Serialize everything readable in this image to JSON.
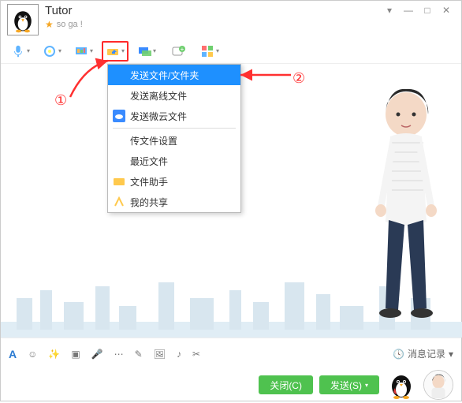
{
  "header": {
    "contact_name": "Tutor",
    "status_text": "so ga !"
  },
  "win_controls": {
    "options": "▾",
    "min": "—",
    "max": "□",
    "close": "✕"
  },
  "toolbar": {
    "voice_icon": "voice",
    "video_icon": "video",
    "screen_icon": "screen",
    "file_icon": "file",
    "remote_icon": "remote",
    "add_icon": "add",
    "app_icon": "apps"
  },
  "dropdown": {
    "items": [
      {
        "label": "发送文件/文件夹",
        "icon": ""
      },
      {
        "label": "发送离线文件",
        "icon": ""
      },
      {
        "label": "发送微云文件",
        "icon": "cloud"
      },
      {
        "label": "传文件设置",
        "icon": ""
      },
      {
        "label": "最近文件",
        "icon": ""
      },
      {
        "label": "文件助手",
        "icon": "folder"
      },
      {
        "label": "我的共享",
        "icon": "share"
      }
    ]
  },
  "annotations": {
    "one": "①",
    "two": "②"
  },
  "format_bar": {
    "font": "A",
    "history_label": "消息记录"
  },
  "bottom": {
    "close_label": "关闭(C)",
    "send_label": "发送(S)"
  }
}
